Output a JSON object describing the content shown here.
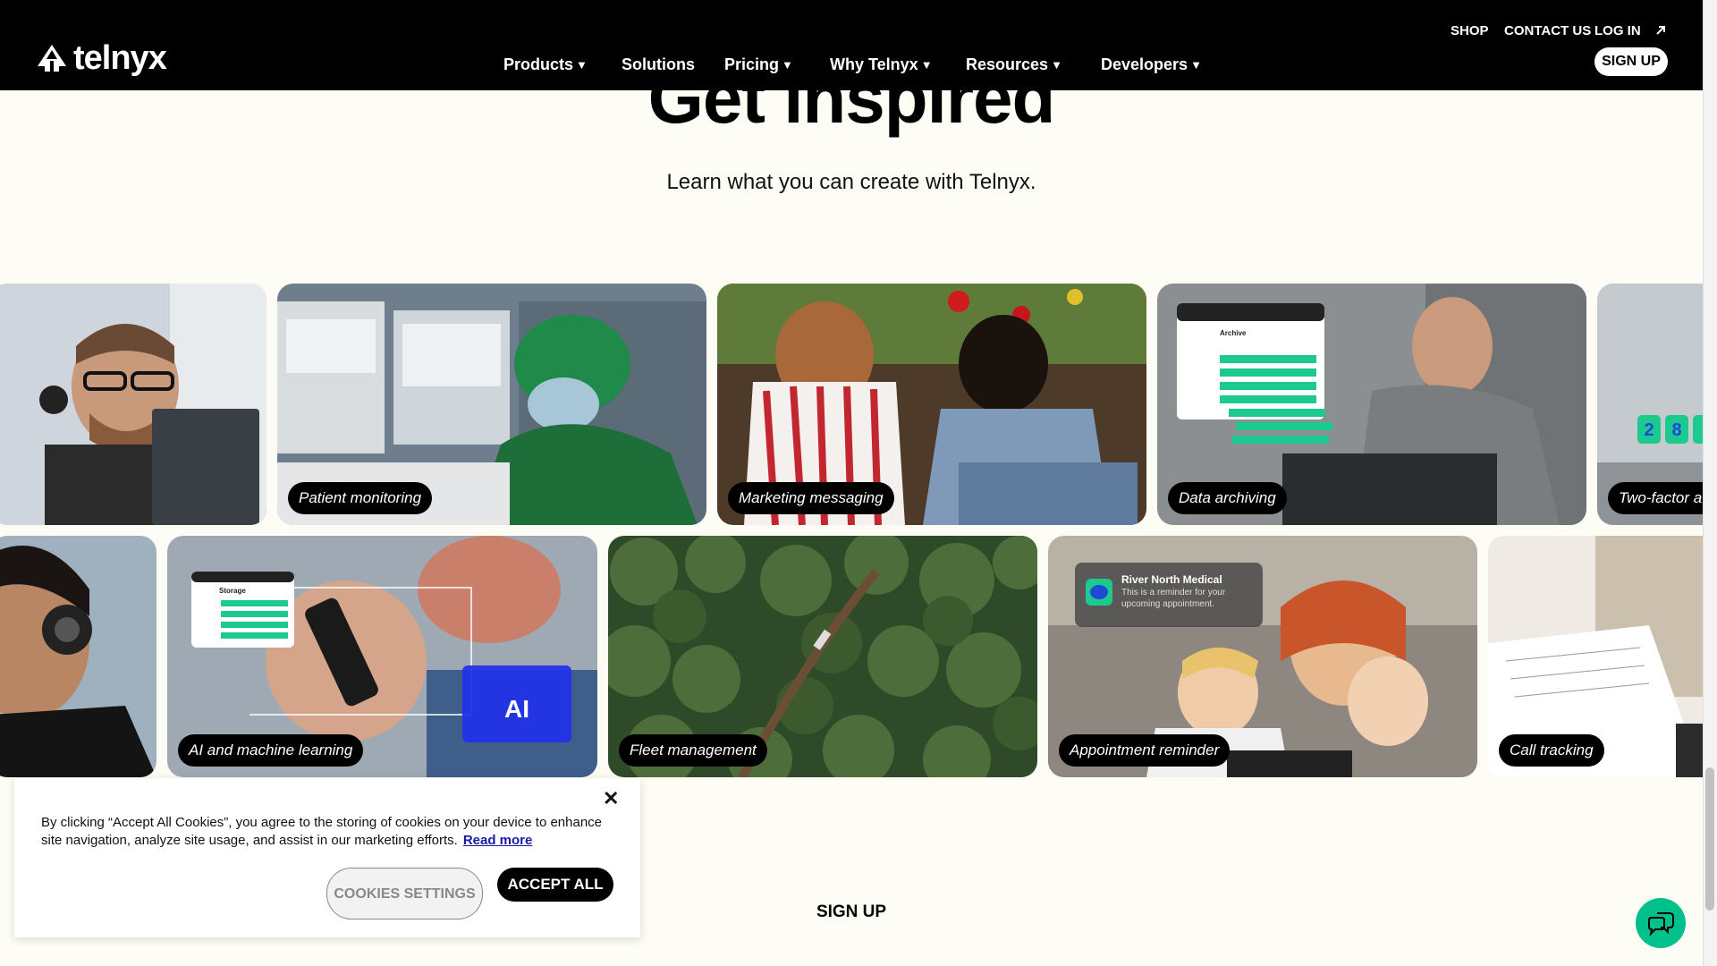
{
  "header": {
    "brand": "telnyx",
    "util_links": [
      "SHOP",
      "CONTACT US",
      "LOG IN"
    ],
    "nav": [
      {
        "label": "Products",
        "caret": true
      },
      {
        "label": "Solutions",
        "caret": false
      },
      {
        "label": "Pricing",
        "caret": true
      },
      {
        "label": "Why Telnyx",
        "caret": true
      },
      {
        "label": "Resources",
        "caret": true
      },
      {
        "label": "Developers",
        "caret": true
      }
    ],
    "signup_label": "SIGN UP"
  },
  "hero": {
    "title": "Get inspired",
    "subtitle": "Learn what you can create with Telnyx."
  },
  "cards_row1": [
    {
      "label": ""
    },
    {
      "label": "Patient monitoring"
    },
    {
      "label": "Marketing messaging"
    },
    {
      "label": "Data archiving"
    },
    {
      "label": "Two-factor a"
    }
  ],
  "cards_row2": [
    {
      "label": ""
    },
    {
      "label": "AI and machine learning"
    },
    {
      "label": "Fleet management"
    },
    {
      "label": "Appointment reminder"
    },
    {
      "label": "Call tracking"
    }
  ],
  "card_overlays": {
    "archive_title": "Archive",
    "storage_title": "Storage",
    "ai_badge": "AI",
    "reminder_title": "River North Medical",
    "reminder_text": "This is a reminder for your upcoming appointment.",
    "code_digits": [
      "2",
      "8"
    ]
  },
  "cookie": {
    "text": "By clicking “Accept All Cookies”, you agree to the storing of cookies on your device to enhance site navigation, analyze site usage, and assist in our marketing efforts.",
    "read_more": "Read more",
    "settings_label": "COOKIES SETTINGS",
    "accept_label": "ACCEPT ALL"
  },
  "footer": {
    "signup_label": "SIGN UP"
  },
  "colors": {
    "page_bg": "#fefdf5",
    "header_bg": "#000000",
    "accent_green": "#00c08b"
  }
}
